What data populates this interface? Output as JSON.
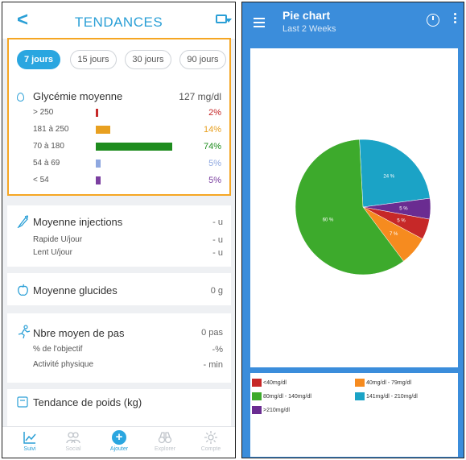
{
  "left": {
    "header": {
      "back_glyph": "<",
      "title": "TENDANCES",
      "export_icon": "export-icon"
    },
    "periods": [
      {
        "label": "7 jours",
        "active": true
      },
      {
        "label": "15 jours",
        "active": false
      },
      {
        "label": "30 jours",
        "active": false
      },
      {
        "label": "90 jours",
        "active": false
      }
    ],
    "glycemia": {
      "label": "Glycémie moyenne",
      "value": "127 mg/dl",
      "rows": [
        {
          "range": "> 250",
          "pct": "2%",
          "fraction": 0.02,
          "color": "#c62828"
        },
        {
          "range": "181 à 250",
          "pct": "14%",
          "fraction": 0.14,
          "color": "#e8a020"
        },
        {
          "range": "70 à 180",
          "pct": "74%",
          "fraction": 0.74,
          "color": "#1e8c1e"
        },
        {
          "range": "54 à 69",
          "pct": "5%",
          "fraction": 0.05,
          "color": "#8fa8e0"
        },
        {
          "range": "< 54",
          "pct": "5%",
          "fraction": 0.05,
          "color": "#7b3fa0"
        }
      ]
    },
    "injections": {
      "title": "Moyenne injections",
      "title_value": "- u",
      "rapide_label": "Rapide U/jour",
      "rapide_value": "- u",
      "lent_label": "Lent U/jour",
      "lent_value": "- u"
    },
    "glucides": {
      "title": "Moyenne glucides",
      "value": "0 g"
    },
    "pas": {
      "title": "Nbre moyen de pas",
      "value": "0 pas",
      "objectif_label": "% de l'objectif",
      "objectif_value": "-%",
      "activite_label": "Activité physique",
      "activite_value": "- min"
    },
    "poids": {
      "title": "Tendance de poids (kg)"
    },
    "nav": [
      {
        "label": "Suivi",
        "icon": "chart-icon",
        "active": true
      },
      {
        "label": "Social",
        "icon": "people-icon",
        "active": false
      },
      {
        "label": "Ajouter",
        "icon": "plus-icon",
        "active": false
      },
      {
        "label": "Explorer",
        "icon": "binoculars-icon",
        "active": false
      },
      {
        "label": "Compte",
        "icon": "gear-icon",
        "active": false
      }
    ]
  },
  "right": {
    "header": {
      "title": "Pie chart",
      "subtitle": "Last 2 Weeks",
      "menu_icon": "menu-icon",
      "timer_icon": "timer-icon",
      "more_icon": "more-icon"
    },
    "accent": "#3b8ddb"
  },
  "chart_data": {
    "type": "pie",
    "title": "",
    "slices": [
      {
        "label": "<40mg/dl",
        "value": 5,
        "data_label": "5 %",
        "color": "#c62828"
      },
      {
        "label": "40mg/dl - 79mg/dl",
        "value": 7,
        "data_label": "7 %",
        "color": "#f68b1f"
      },
      {
        "label": "80mg/dl - 140mg/dl",
        "value": 60,
        "data_label": "60 %",
        "color": "#3daa2c"
      },
      {
        "label": "141mg/dl - 210mg/dl",
        "value": 24,
        "data_label": "24 %",
        "color": "#1ba3c6"
      },
      {
        "label": ">210mg/dl",
        "value": 5,
        "data_label": "5 %",
        "color": "#6a2c91"
      }
    ],
    "legend_position": "bottom"
  }
}
